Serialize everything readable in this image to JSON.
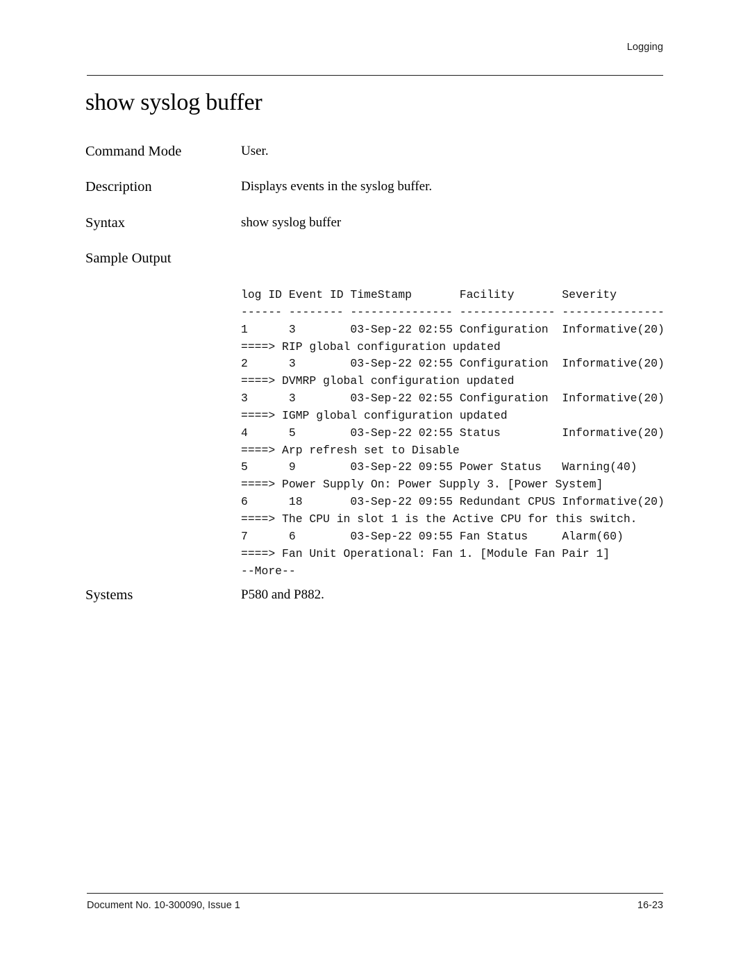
{
  "header": {
    "running_head": "Logging"
  },
  "title": "show syslog buffer",
  "definitions": [
    {
      "label": "Command Mode",
      "value": "User."
    },
    {
      "label": "Description",
      "value": "Displays events in the syslog buffer."
    },
    {
      "label": "Syntax",
      "value": "show syslog buffer"
    },
    {
      "label": "Sample Output",
      "value": ""
    },
    {
      "label": "Systems",
      "value": "P580 and P882."
    }
  ],
  "sample_output": {
    "columns": [
      "log ID",
      "Event ID",
      "TimeStamp",
      "Facility",
      "Severity"
    ],
    "separator": "------ -------- --------------- -------------- ---------------",
    "entries": [
      {
        "log_id": "1",
        "event_id": "3",
        "timestamp": "03-Sep-22 02:55",
        "facility": "Configuration",
        "severity": "Informative(20)",
        "detail": "====> RIP global configuration updated"
      },
      {
        "log_id": "2",
        "event_id": "3",
        "timestamp": "03-Sep-22 02:55",
        "facility": "Configuration",
        "severity": "Informative(20)",
        "detail": "====> DVMRP global configuration updated"
      },
      {
        "log_id": "3",
        "event_id": "3",
        "timestamp": "03-Sep-22 02:55",
        "facility": "Configuration",
        "severity": "Informative(20)",
        "detail": "====> IGMP global configuration updated"
      },
      {
        "log_id": "4",
        "event_id": "5",
        "timestamp": "03-Sep-22 02:55",
        "facility": "Status",
        "severity": "Informative(20)",
        "detail": "====> Arp refresh set to Disable"
      },
      {
        "log_id": "5",
        "event_id": "9",
        "timestamp": "03-Sep-22 09:55",
        "facility": "Power Status",
        "severity": "Warning(40)",
        "detail": "====> Power Supply On: Power Supply 3. [Power System]"
      },
      {
        "log_id": "6",
        "event_id": "18",
        "timestamp": "03-Sep-22 09:55",
        "facility": "Redundant CPUS",
        "severity": "Informative(20)",
        "detail": "====> The CPU in slot 1 is the Active CPU for this switch."
      },
      {
        "log_id": "7",
        "event_id": "6",
        "timestamp": "03-Sep-22 09:55",
        "facility": "Fan Status",
        "severity": "Alarm(60)",
        "detail": "====> Fan Unit Operational: Fan 1. [Module Fan Pair 1]"
      }
    ],
    "more_prompt": "--More--",
    "lines": [
      "log ID Event ID TimeStamp       Facility       Severity",
      "------ -------- --------------- -------------- ---------------",
      "1      3        03-Sep-22 02:55 Configuration  Informative(20)",
      "====> RIP global configuration updated",
      "2      3        03-Sep-22 02:55 Configuration  Informative(20)",
      "====> DVMRP global configuration updated",
      "3      3        03-Sep-22 02:55 Configuration  Informative(20)",
      "====> IGMP global configuration updated",
      "4      5        03-Sep-22 02:55 Status         Informative(20)",
      "====> Arp refresh set to Disable",
      "5      9        03-Sep-22 09:55 Power Status   Warning(40)",
      "====> Power Supply On: Power Supply 3. [Power System]",
      "6      18       03-Sep-22 09:55 Redundant CPUS Informative(20)",
      "====> The CPU in slot 1 is the Active CPU for this switch.",
      "7      6        03-Sep-22 09:55 Fan Status     Alarm(60)",
      "====> Fan Unit Operational: Fan 1. [Module Fan Pair 1]",
      "--More--"
    ]
  },
  "footer": {
    "document": "Document No. 10-300090, Issue 1",
    "page_number": "16-23"
  }
}
